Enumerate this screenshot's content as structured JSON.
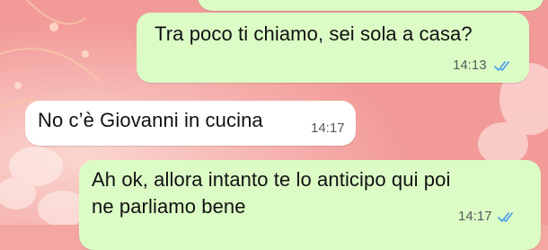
{
  "chat": {
    "messages": [
      {
        "direction": "outgoing",
        "text": "Tra poco ti chiamo, sei sola a casa?",
        "time": "14:13",
        "status_icon": "double-check-read-icon"
      },
      {
        "direction": "incoming",
        "text": "No c’è Giovanni in cucina",
        "time": "14:17"
      },
      {
        "direction": "outgoing",
        "lines": [
          "Ah ok, allora intanto te lo anticipo qui poi",
          "ne parliamo bene"
        ],
        "time": "14:17",
        "status_icon": "double-check-read-icon"
      }
    ]
  },
  "colors": {
    "outgoing_bubble": "#dcfcc6",
    "incoming_bubble": "#ffffff",
    "read_ticks": "#4fa3e8",
    "wallpaper": "#f4a6a2"
  }
}
